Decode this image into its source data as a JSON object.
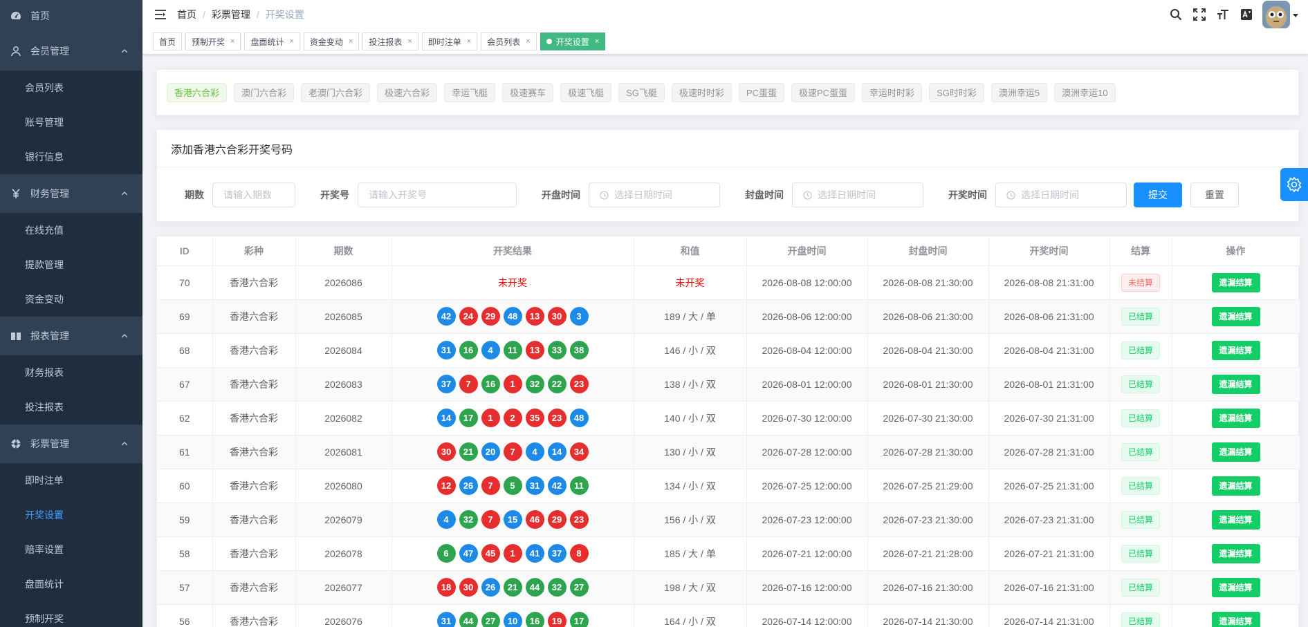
{
  "sidebar": {
    "home": "首页",
    "groups": [
      {
        "title": "会员管理",
        "items": [
          "会员列表",
          "账号管理",
          "银行信息"
        ]
      },
      {
        "title": "财务管理",
        "items": [
          "在线充值",
          "提款管理",
          "资金变动"
        ]
      },
      {
        "title": "报表管理",
        "items": [
          "财务报表",
          "投注报表"
        ]
      },
      {
        "title": "彩票管理",
        "items": [
          "即时注单",
          "开奖设置",
          "赔率设置",
          "盘面统计",
          "预制开奖"
        ]
      }
    ],
    "active_item": "开奖设置"
  },
  "breadcrumb": [
    "首页",
    "彩票管理",
    "开奖设置"
  ],
  "tags": [
    {
      "label": "首页",
      "closable": false
    },
    {
      "label": "预制开奖",
      "closable": true
    },
    {
      "label": "盘面统计",
      "closable": true
    },
    {
      "label": "资金变动",
      "closable": true
    },
    {
      "label": "投注报表",
      "closable": true
    },
    {
      "label": "即时注单",
      "closable": true
    },
    {
      "label": "会员列表",
      "closable": true
    },
    {
      "label": "开奖设置",
      "closable": true,
      "active": true
    }
  ],
  "tag_close": "×",
  "lotteries": [
    "香港六合彩",
    "澳门六合彩",
    "老澳门六合彩",
    "极速六合彩",
    "幸运飞艇",
    "极速赛车",
    "极速飞艇",
    "SG飞艇",
    "极速时时彩",
    "PC蛋蛋",
    "极速PC蛋蛋",
    "幸运时时彩",
    "SG时时彩",
    "澳洲幸运5",
    "澳洲幸运10"
  ],
  "form": {
    "title": "添加香港六合彩开奖号码",
    "period_label": "期数",
    "period_placeholder": "请输入期数",
    "number_label": "开奖号",
    "number_placeholder": "请输入开奖号",
    "open_label": "开盘时间",
    "close_label": "封盘时间",
    "draw_label": "开奖时间",
    "date_placeholder": "选择日期时间",
    "submit": "提交",
    "reset": "重置"
  },
  "table": {
    "headers": [
      "ID",
      "彩种",
      "期数",
      "开奖结果",
      "和值",
      "开盘时间",
      "封盘时间",
      "开奖时间",
      "结算",
      "操作"
    ],
    "op_label": "遗漏结算",
    "rows": [
      {
        "id": "70",
        "type": "香港六合彩",
        "period": "2026086",
        "balls": [],
        "result_text": "未开奖",
        "sum": "未开奖",
        "open": "2026-08-08 12:00:00",
        "close": "2026-08-08 21:30:00",
        "draw": "2026-08-08 21:31:00",
        "status": "未结算",
        "settled": false
      },
      {
        "id": "69",
        "type": "香港六合彩",
        "period": "2026085",
        "balls": [
          [
            "42",
            "blue"
          ],
          [
            "24",
            "red"
          ],
          [
            "29",
            "red"
          ],
          [
            "48",
            "blue"
          ],
          [
            "13",
            "red"
          ],
          [
            "30",
            "red"
          ],
          [
            "3",
            "blue"
          ]
        ],
        "sum": "189 / 大 / 单",
        "open": "2026-08-06 12:00:00",
        "close": "2026-08-06 21:30:00",
        "draw": "2026-08-06 21:31:00",
        "status": "已结算",
        "settled": true
      },
      {
        "id": "68",
        "type": "香港六合彩",
        "period": "2026084",
        "balls": [
          [
            "31",
            "blue"
          ],
          [
            "16",
            "green"
          ],
          [
            "4",
            "blue"
          ],
          [
            "11",
            "green"
          ],
          [
            "13",
            "red"
          ],
          [
            "33",
            "green"
          ],
          [
            "38",
            "green"
          ]
        ],
        "sum": "146 / 小 / 双",
        "open": "2026-08-04 12:00:00",
        "close": "2026-08-04 21:30:00",
        "draw": "2026-08-04 21:31:00",
        "status": "已结算",
        "settled": true
      },
      {
        "id": "67",
        "type": "香港六合彩",
        "period": "2026083",
        "balls": [
          [
            "37",
            "blue"
          ],
          [
            "7",
            "red"
          ],
          [
            "16",
            "green"
          ],
          [
            "1",
            "red"
          ],
          [
            "32",
            "green"
          ],
          [
            "22",
            "green"
          ],
          [
            "23",
            "red"
          ]
        ],
        "sum": "138 / 小 / 双",
        "open": "2026-08-01 12:00:00",
        "close": "2026-08-01 21:30:00",
        "draw": "2026-08-01 21:31:00",
        "status": "已结算",
        "settled": true
      },
      {
        "id": "62",
        "type": "香港六合彩",
        "period": "2026082",
        "balls": [
          [
            "14",
            "blue"
          ],
          [
            "17",
            "green"
          ],
          [
            "1",
            "red"
          ],
          [
            "2",
            "red"
          ],
          [
            "35",
            "red"
          ],
          [
            "23",
            "red"
          ],
          [
            "48",
            "blue"
          ]
        ],
        "sum": "140 / 小 / 双",
        "open": "2026-07-30 12:00:00",
        "close": "2026-07-30 21:30:00",
        "draw": "2026-07-30 21:31:00",
        "status": "已结算",
        "settled": true
      },
      {
        "id": "61",
        "type": "香港六合彩",
        "period": "2026081",
        "balls": [
          [
            "30",
            "red"
          ],
          [
            "21",
            "green"
          ],
          [
            "20",
            "blue"
          ],
          [
            "7",
            "red"
          ],
          [
            "4",
            "blue"
          ],
          [
            "14",
            "blue"
          ],
          [
            "34",
            "red"
          ]
        ],
        "sum": "130 / 小 / 双",
        "open": "2026-07-28 12:00:00",
        "close": "2026-07-28 21:30:00",
        "draw": "2026-07-28 21:31:00",
        "status": "已结算",
        "settled": true
      },
      {
        "id": "60",
        "type": "香港六合彩",
        "period": "2026080",
        "balls": [
          [
            "12",
            "red"
          ],
          [
            "26",
            "blue"
          ],
          [
            "7",
            "red"
          ],
          [
            "5",
            "green"
          ],
          [
            "31",
            "blue"
          ],
          [
            "42",
            "blue"
          ],
          [
            "11",
            "green"
          ]
        ],
        "sum": "134 / 小 / 双",
        "open": "2026-07-25 12:00:00",
        "close": "2026-07-25 21:29:00",
        "draw": "2026-07-25 21:31:00",
        "status": "已结算",
        "settled": true
      },
      {
        "id": "59",
        "type": "香港六合彩",
        "period": "2026079",
        "balls": [
          [
            "4",
            "blue"
          ],
          [
            "32",
            "green"
          ],
          [
            "7",
            "red"
          ],
          [
            "15",
            "blue"
          ],
          [
            "46",
            "red"
          ],
          [
            "29",
            "red"
          ],
          [
            "23",
            "red"
          ]
        ],
        "sum": "156 / 小 / 双",
        "open": "2026-07-23 12:00:00",
        "close": "2026-07-23 21:30:00",
        "draw": "2026-07-23 21:31:00",
        "status": "已结算",
        "settled": true
      },
      {
        "id": "58",
        "type": "香港六合彩",
        "period": "2026078",
        "balls": [
          [
            "6",
            "green"
          ],
          [
            "47",
            "blue"
          ],
          [
            "45",
            "red"
          ],
          [
            "1",
            "red"
          ],
          [
            "41",
            "blue"
          ],
          [
            "37",
            "blue"
          ],
          [
            "8",
            "red"
          ]
        ],
        "sum": "185 / 大 / 单",
        "open": "2026-07-21 12:00:00",
        "close": "2026-07-21 21:28:00",
        "draw": "2026-07-21 21:31:00",
        "status": "已结算",
        "settled": true
      },
      {
        "id": "57",
        "type": "香港六合彩",
        "period": "2026077",
        "balls": [
          [
            "18",
            "red"
          ],
          [
            "30",
            "red"
          ],
          [
            "26",
            "blue"
          ],
          [
            "21",
            "green"
          ],
          [
            "44",
            "green"
          ],
          [
            "32",
            "green"
          ],
          [
            "27",
            "green"
          ]
        ],
        "sum": "198 / 大 / 双",
        "open": "2026-07-16 12:00:00",
        "close": "2026-07-16 21:30:00",
        "draw": "2026-07-16 21:31:00",
        "status": "已结算",
        "settled": true
      },
      {
        "id": "56",
        "type": "香港六合彩",
        "period": "2026076",
        "balls": [
          [
            "31",
            "blue"
          ],
          [
            "44",
            "green"
          ],
          [
            "27",
            "green"
          ],
          [
            "10",
            "blue"
          ],
          [
            "16",
            "green"
          ],
          [
            "19",
            "red"
          ],
          [
            "17",
            "green"
          ]
        ],
        "sum": "164 / 小 / 双",
        "open": "2026-07-14 12:00:00",
        "close": "2026-07-14 21:30:00",
        "draw": "2026-07-14 21:31:00",
        "status": "已结算",
        "settled": true
      }
    ]
  },
  "icons": {
    "home": "dashboard-icon",
    "member": "user-icon",
    "finance": "yen-icon",
    "report": "report-icon",
    "lottery": "lottery-icon",
    "toolbar": [
      "search-icon",
      "fullscreen-icon",
      "font-size-icon",
      "translate-icon"
    ]
  },
  "colors": {
    "sidebar_bg": "#304156",
    "accent": "#409eff",
    "ball_red": "#e62e2e",
    "ball_blue": "#1c8ae6",
    "ball_green": "#2ea44f",
    "settle_green": "#13ce66"
  }
}
